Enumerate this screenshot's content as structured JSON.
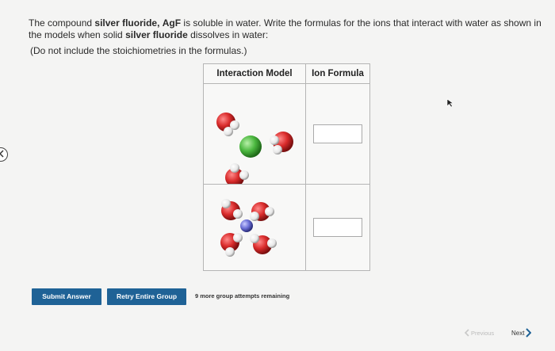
{
  "question": {
    "part1": "The compound ",
    "compound_name_1": "silver fluoride,",
    "space": " ",
    "formula": "AgF",
    "part2": " is soluble in water. Write the formulas for the ions that interact with water as shown in the models when solid ",
    "compound_name_2": "silver fluoride",
    "part3": " dissolves in water:",
    "note": "(Do not include the stoichiometries in the formulas.)"
  },
  "table": {
    "header_model": "Interaction Model",
    "header_formula": "Ion Formula",
    "rows": [
      {
        "formula_value": "",
        "ion_color": "#4cb840"
      },
      {
        "formula_value": "",
        "ion_color": "#6b6fd6"
      }
    ]
  },
  "buttons": {
    "submit": "Submit Answer",
    "retry": "Retry Entire Group"
  },
  "attempts_text": "9 more group attempts remaining",
  "nav": {
    "previous": "Previous",
    "next": "Next"
  },
  "colors": {
    "button_bg": "#1f6296",
    "oxygen": "#d92b2b",
    "hydrogen": "#f0f0f0"
  }
}
